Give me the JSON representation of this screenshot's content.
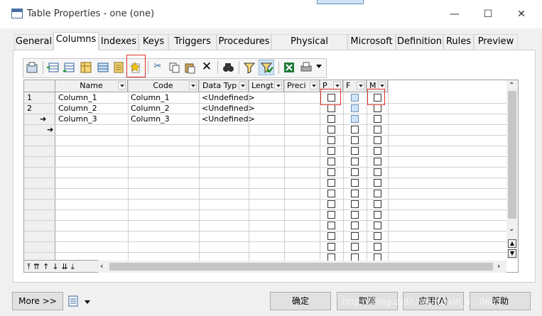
{
  "window": {
    "title": "Table Properties - one (one)",
    "controls": [
      "—",
      "☐",
      "✕"
    ]
  },
  "tabs": [
    {
      "label": "General"
    },
    {
      "label": "Columns"
    },
    {
      "label": "Indexes"
    },
    {
      "label": "Keys"
    },
    {
      "label": "Triggers"
    },
    {
      "label": "Procedures"
    },
    {
      "label": "Physical Options"
    },
    {
      "label": "Microsoft"
    },
    {
      "label": "Definition"
    },
    {
      "label": "Rules"
    },
    {
      "label": "Preview"
    }
  ],
  "active_tab": "Columns",
  "toolbar": {
    "icons": [
      "properties-icon",
      "insert-row-icon",
      "add-row-icon",
      "add-columns-icon",
      "add-domain-icon",
      "list-icon",
      "new-column-icon",
      "cut-icon",
      "copy-icon",
      "paste-icon",
      "delete-icon",
      "find-icon",
      "filter-icon",
      "customize-columns-icon",
      "excel-icon",
      "print-icon",
      "dropdown-icon"
    ]
  },
  "grid": {
    "headers": [
      "Name",
      "Code",
      "Data Typ",
      "Lengt",
      "Preci",
      "P",
      "F",
      "M"
    ],
    "rows": [
      {
        "num": "1",
        "marker": "",
        "name": "Column_1",
        "code": "Column_1",
        "type": "<Undefined>"
      },
      {
        "num": "2",
        "marker": "",
        "name": "Column_2",
        "code": "Column_2",
        "type": "<Undefined>"
      },
      {
        "num": "",
        "marker": "➜",
        "name": "Column_3",
        "code": "Column_3",
        "type": "<Undefined>"
      },
      {
        "num": "",
        "marker": "➜",
        "name": "",
        "code": "",
        "type": ""
      }
    ]
  },
  "nav_buttons": [
    "⤒",
    "⇈",
    "↑",
    "↓",
    "⇊",
    "⤓"
  ],
  "footer": {
    "more_label": "More >>",
    "ok_label": "确定",
    "cancel_label": "取消",
    "apply_label": "应用(A)",
    "help_label": "帮助"
  },
  "watermark": "https://blog.csdn.net/weixin_4…0683"
}
